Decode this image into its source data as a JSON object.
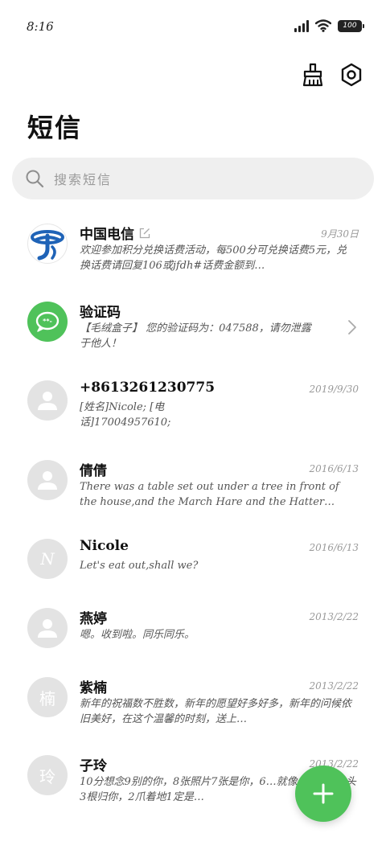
{
  "status_bar": {
    "time": "8:16",
    "battery": "100"
  },
  "header": {
    "title": "短信"
  },
  "search": {
    "placeholder": "搜索短信"
  },
  "messages": [
    {
      "name": "中国电信",
      "date": "9月30日",
      "preview": "欢迎参加积分兑换话费活动，每500分可兑换话费5元，兑换话费请回复106或jfdh#话费金额到…",
      "avatar_type": "logo"
    },
    {
      "name": "验证码",
      "date": "",
      "preview": "【毛绒盒子】 您的验证码为：047588，请勿泄露于他人！",
      "avatar_type": "bubble"
    },
    {
      "name": "+8613261230775",
      "date": "2019/9/30",
      "preview": "[姓名]Nicole; [电话]17004957610;",
      "avatar_type": "person"
    },
    {
      "name": "倩倩",
      "date": "2016/6/13",
      "preview": "There was a table set out under a tree in front of the house,and the March Hare and the Hatter were…",
      "avatar_type": "person"
    },
    {
      "name": "Nicole",
      "date": "2016/6/13",
      "preview": "Let's eat out,shall we?",
      "avatar_type": "letter",
      "avatar_text": "N"
    },
    {
      "name": "燕婷",
      "date": "2013/2/22",
      "preview": "嗯。收到啦。同乐同乐。",
      "avatar_type": "person"
    },
    {
      "name": "紫楠",
      "date": "2013/2/22",
      "preview": "新年的祝福数不胜数，新年的愿望好多好多，新年的问候依旧美好，在这个温馨的时刻，送上…",
      "avatar_type": "char",
      "avatar_text": "楠"
    },
    {
      "name": "子玲",
      "date": "2013/2/22",
      "preview": "10分想念9别的你，8张照片7张是你，6…就像你，4根骨头3根归你，2爪着地1定是…",
      "avatar_type": "char",
      "avatar_text": "玲"
    }
  ],
  "colors": {
    "accent": "#4fc25a",
    "avatar_bg": "#e3e3e3",
    "search_bg": "#efefef",
    "telecom_blue": "#1f63b7"
  }
}
